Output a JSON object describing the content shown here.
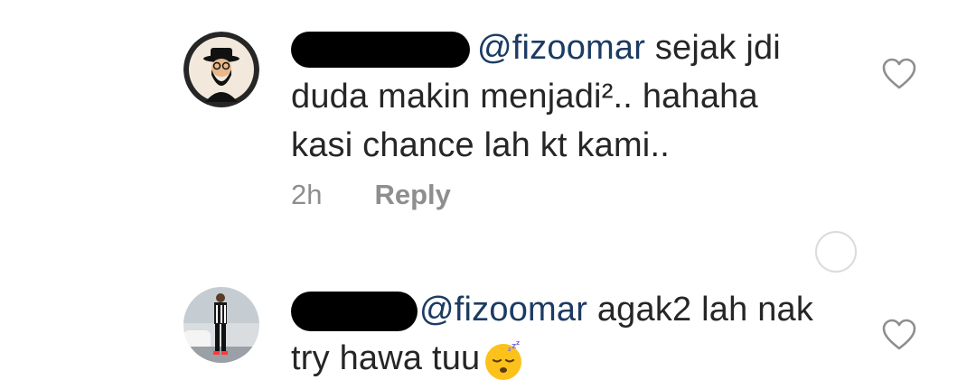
{
  "comments": [
    {
      "mention": "@fizoomar",
      "text_line1": " sejak jdi",
      "text_line2": "duda makin menjadi².. hahaha",
      "text_line3": "kasi chance lah kt kami..",
      "time": "2h",
      "reply_label": "Reply"
    },
    {
      "mention": "@fizoomar",
      "text_line1": " agak2 lah nak",
      "text_line2": "try hawa tuu"
    }
  ],
  "icons": {
    "like": "heart-outline-icon",
    "emoji": "sleeping-face-emoji",
    "status": "empty-circle-icon"
  },
  "colors": {
    "mention": "#1c3b63",
    "meta": "#8e8e8e",
    "text": "#262626"
  }
}
